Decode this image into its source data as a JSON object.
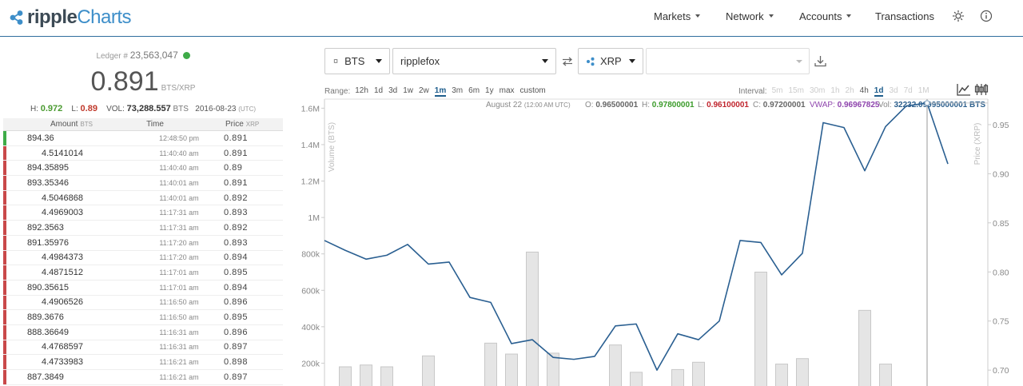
{
  "app": {
    "logo_part1": "ripple",
    "logo_part2": "Charts"
  },
  "nav": {
    "markets": "Markets",
    "network": "Network",
    "accounts": "Accounts",
    "transactions": "Transactions",
    "theme_icon": "sun-icon",
    "info_icon": "info-icon"
  },
  "summary": {
    "ledger_label": "Ledger #",
    "ledger_number": "23,563,047",
    "last_price": "0.891",
    "pair": "BTS/XRP",
    "high_label": "H:",
    "high": "0.972",
    "low_label": "L:",
    "low": "0.89",
    "vol_label": "VOL:",
    "vol": "73,288.557",
    "vol_unit": "BTS",
    "date": "2016-08-23",
    "tz": "(UTC)"
  },
  "trades": {
    "header_amount": "Amount",
    "header_amount_unit": "BTS",
    "header_time": "Time",
    "header_price": "Price",
    "header_price_unit": "XRP",
    "rows": [
      {
        "side": "buy",
        "amount": "894.36",
        "time": "12:48:50 pm",
        "price": "0.891"
      },
      {
        "side": "sell",
        "amount": "4.5141014",
        "time": "11:40:40 am",
        "price": "0.891"
      },
      {
        "side": "sell",
        "amount": "894.35895",
        "time": "11:40:40 am",
        "price": "0.89"
      },
      {
        "side": "sell",
        "amount": "893.35346",
        "time": "11:40:01 am",
        "price": "0.891"
      },
      {
        "side": "sell",
        "amount": "4.5046868",
        "time": "11:40:01 am",
        "price": "0.892"
      },
      {
        "side": "sell",
        "amount": "4.4969003",
        "time": "11:17:31 am",
        "price": "0.893"
      },
      {
        "side": "sell",
        "amount": "892.3563",
        "time": "11:17:31 am",
        "price": "0.892"
      },
      {
        "side": "sell",
        "amount": "891.35976",
        "time": "11:17:20 am",
        "price": "0.893"
      },
      {
        "side": "sell",
        "amount": "4.4984373",
        "time": "11:17:20 am",
        "price": "0.894"
      },
      {
        "side": "sell",
        "amount": "4.4871512",
        "time": "11:17:01 am",
        "price": "0.895"
      },
      {
        "side": "sell",
        "amount": "890.35615",
        "time": "11:17:01 am",
        "price": "0.894"
      },
      {
        "side": "sell",
        "amount": "4.4906526",
        "time": "11:16:50 am",
        "price": "0.896"
      },
      {
        "side": "sell",
        "amount": "889.3676",
        "time": "11:16:50 am",
        "price": "0.895"
      },
      {
        "side": "sell",
        "amount": "888.36649",
        "time": "11:16:31 am",
        "price": "0.896"
      },
      {
        "side": "sell",
        "amount": "4.4768597",
        "time": "11:16:31 am",
        "price": "0.897"
      },
      {
        "side": "sell",
        "amount": "4.4733983",
        "time": "11:16:21 am",
        "price": "0.898"
      },
      {
        "side": "sell",
        "amount": "887.3849",
        "time": "11:16:21 am",
        "price": "0.897"
      }
    ]
  },
  "controls": {
    "base_currency": "BTS",
    "base_issuer": "ripplefox",
    "swap_icon": "swap-arrows-icon",
    "counter_currency": "XRP",
    "counter_issuer": "",
    "download_icon": "download-icon",
    "range_label": "Range:",
    "ranges": [
      "12h",
      "1d",
      "3d",
      "1w",
      "2w",
      "1m",
      "3m",
      "6m",
      "1y",
      "max",
      "custom"
    ],
    "range_selected": "1m",
    "interval_label": "Interval:",
    "intervals": [
      {
        "label": "5m",
        "enabled": false
      },
      {
        "label": "15m",
        "enabled": false
      },
      {
        "label": "30m",
        "enabled": false
      },
      {
        "label": "1h",
        "enabled": false
      },
      {
        "label": "2h",
        "enabled": false
      },
      {
        "label": "4h",
        "enabled": true
      },
      {
        "label": "1d",
        "enabled": true
      },
      {
        "label": "3d",
        "enabled": false
      },
      {
        "label": "7d",
        "enabled": false
      },
      {
        "label": "1M",
        "enabled": false
      }
    ],
    "interval_selected": "1d",
    "line_chart_icon": "line-chart-icon",
    "candle_chart_icon": "candlestick-icon"
  },
  "ohlc": {
    "date": "August 22",
    "time": "(12:00 AM UTC)",
    "open_label": "O:",
    "open": "0.96500001",
    "high_label": "H:",
    "high": "0.97800001",
    "low_label": "L:",
    "low": "0.96100001",
    "close_label": "C:",
    "close": "0.97200001",
    "vwap_label": "VWAP:",
    "vwap": "0.96967825",
    "vol_label": "Vol:",
    "vol": "32232.09995000001 BTS"
  },
  "chart_data": {
    "type": "line",
    "left_axis_label": "Volume (BTS)",
    "right_axis_label": "Price (XRP)",
    "left_ticks": [
      "200k",
      "400k",
      "600k",
      "800k",
      "1M",
      "1.2M",
      "1.4M",
      "1.6M"
    ],
    "left_tick_values": [
      200000,
      400000,
      600000,
      800000,
      1000000,
      1200000,
      1400000,
      1600000
    ],
    "right_ticks": [
      "0.70",
      "0.75",
      "0.80",
      "0.85",
      "0.90",
      "0.95"
    ],
    "right_tick_values": [
      0.7,
      0.75,
      0.8,
      0.85,
      0.9,
      0.95
    ],
    "volume_range": [
      0,
      1650000
    ],
    "price_range": [
      0.67,
      0.976
    ],
    "series": [
      {
        "name": "Price",
        "values": [
          0.832,
          0.822,
          0.813,
          0.817,
          0.828,
          0.808,
          0.81,
          0.774,
          0.769,
          0.727,
          0.731,
          0.713,
          0.711,
          0.714,
          0.745,
          0.747,
          0.7,
          0.737,
          0.731,
          0.75,
          0.832,
          0.83,
          0.797,
          0.819,
          0.952,
          0.947,
          0.903,
          0.948,
          0.969,
          0.972,
          0.91
        ]
      },
      {
        "name": "Volume",
        "values": [
          null,
          180000,
          190000,
          180000,
          null,
          240000,
          null,
          null,
          310000,
          250000,
          810000,
          255000,
          60000,
          null,
          300000,
          150000,
          null,
          165000,
          205000,
          null,
          null,
          700000,
          195000,
          225000,
          70000,
          null,
          490000,
          195000,
          null,
          null,
          null
        ]
      }
    ],
    "hover_index": 29
  }
}
